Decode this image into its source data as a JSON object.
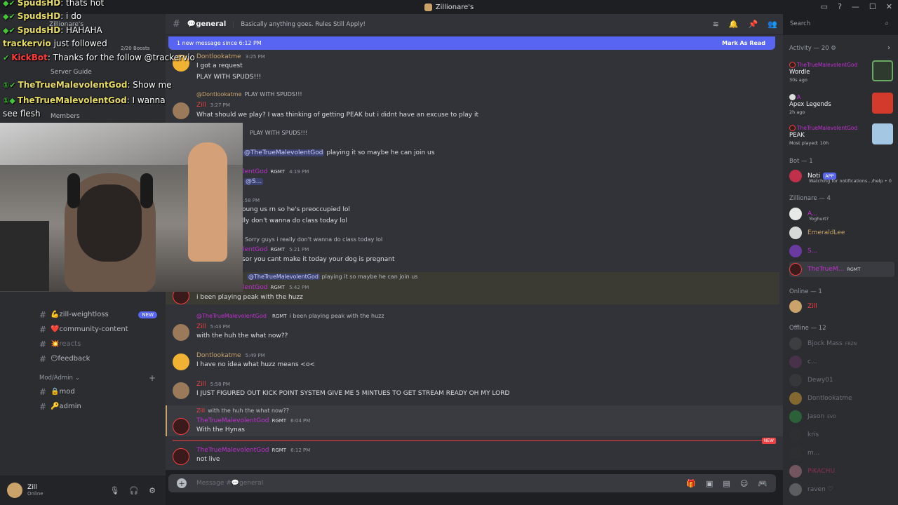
{
  "window": {
    "title": "Zillionare's"
  },
  "server": {
    "name": "Zillionare's",
    "boosts": "2/20 Boosts",
    "server_guide": "Server Guide",
    "members": "Members"
  },
  "channels": [
    {
      "name": "zill-weightloss",
      "emoji": "💪",
      "badge": "NEW"
    },
    {
      "name": "community-content",
      "emoji": "❤️"
    },
    {
      "name": "reacts",
      "emoji": "💥",
      "muted": true
    },
    {
      "name": "feedback",
      "emoji": "😶"
    }
  ],
  "category": {
    "name": "Mod/Admin",
    "channels": [
      {
        "name": "mod",
        "emoji": "🔒"
      },
      {
        "name": "admin",
        "emoji": "🔑"
      }
    ]
  },
  "user": {
    "name": "Zill",
    "status": "Online"
  },
  "header": {
    "channel": "💬general",
    "topic": "Basically anything goes. Rules Still Apply!",
    "search_placeholder": "Search"
  },
  "new_bar": {
    "text": "1 new message since 6:12 PM",
    "action": "Mark As Read"
  },
  "messages": [
    {
      "user": "Dontlookatme",
      "time": "3:25 PM",
      "lines": [
        "I got a request",
        "PLAY WITH SPUDS!!!"
      ]
    },
    {
      "reply_user": "@Dontlookatme",
      "reply_text": "PLAY WITH SPUDS!!!",
      "user": "Zill",
      "time": "3:27 PM",
      "lines": [
        "What should we play? I was thinking of getting PEAK but i didnt have an excuse to play it"
      ]
    },
    {
      "reply_text": "PLAY WITH SPUDS!!!",
      "mention": "@TheTrueMalevolentGod",
      "text_after": " playing it so maybe he can join us"
    },
    {
      "user": "lentGod",
      "tag": "RGMT",
      "time": "4:19 PM",
      "mention": "@S..."
    },
    {
      "time": "...58 PM",
      "lines": [
        "oung us rn so he's preoccupied lol",
        "lly don't wanna do class today lol"
      ]
    },
    {
      "reply_text": "Sorry guys i really don't wanna do class today lol",
      "user": "lentGod",
      "tag": "RGMT",
      "time": "5:21 PM",
      "lines": [
        "sor you cant make it today your dog is pregnant"
      ]
    },
    {
      "reply_mention": "@TheTrueMalevolentGod",
      "reply_text": "playing it so maybe he can join us",
      "user": "lentGod",
      "tag": "RGMT",
      "time": "5:42 PM",
      "lines": [
        "i been playing peak with the huzz"
      ]
    },
    {
      "reply_user": "@TheTrueMalevolentGod",
      "reply_tag": "RGMT",
      "reply_text": "i been playing peak with the huzz",
      "user": "Zill",
      "time": "5:43 PM",
      "lines": [
        "with the huh the what now??"
      ]
    },
    {
      "user": "Dontlookatme",
      "time": "5:49 PM",
      "lines": [
        "I have no idea what huzz means <o<"
      ]
    },
    {
      "user": "Zill",
      "time": "5:58 PM",
      "lines": [
        "I JUST FIGURED OUT KICK POINT SYSTEM GIVE ME 5 MINTUES TO GET STREAM READY OH MY LORD"
      ]
    },
    {
      "reply_user": "Zill",
      "reply_text": "with the huh the what now??",
      "user": "TheTrueMalevolentGod",
      "tag": "RGMT",
      "time": "6:04 PM",
      "lines": [
        "With the Hynas"
      ]
    },
    {
      "user": "TheTrueMalevolentGod",
      "tag": "RGMT",
      "time": "6:12 PM",
      "lines": [
        "not live"
      ]
    }
  ],
  "new_divider": "NEW",
  "composer": {
    "placeholder": "Message #💬general"
  },
  "activity": {
    "header": "Activity — 20",
    "items": [
      {
        "user": "TheTrueMalevolentGod",
        "game": "Wordle",
        "sub": "30s ago",
        "color": "#3a3a3a"
      },
      {
        "user": "A",
        "game": "Apex Legends",
        "sub": "2h ago",
        "color": "#d33a2c"
      },
      {
        "user": "TheTrueMalevolentGod",
        "game": "PEAK",
        "sub": "Most played: 10h",
        "color": "#a4c7e3"
      }
    ]
  },
  "bot_section": {
    "header": "Bot — 1",
    "name": "Noti",
    "badge": "APP",
    "sub": "Watching for notifications.. /help • 0"
  },
  "zillionare_section": {
    "header": "Zillionare — 4",
    "members": [
      {
        "name": "A...",
        "sub": "Yoghurt?",
        "color": "#c030d0"
      },
      {
        "name": "EmeraldLee",
        "color": "#c9a36a"
      },
      {
        "name": "S...",
        "color": "#c030d0"
      },
      {
        "name": "TheTrueM...",
        "tag": "RGMT",
        "color": "#c030d0"
      }
    ]
  },
  "online_section": {
    "header": "Online — 1",
    "members": [
      {
        "name": "Zill",
        "color": "#f23f43"
      }
    ]
  },
  "offline_section": {
    "header": "Offline — 12",
    "members": [
      {
        "name": "Bjock Mass",
        "tag": "FRZN"
      },
      {
        "name": "c..."
      },
      {
        "name": "Dewy01"
      },
      {
        "name": "Dontlookatme"
      },
      {
        "name": "Jason",
        "tag": "EVO"
      },
      {
        "name": "kris"
      },
      {
        "name": "m..."
      },
      {
        "name": "PiKACHU"
      },
      {
        "name": "raven ♡"
      }
    ]
  },
  "stream_overlay": [
    {
      "user": "SpudsHD",
      "msg": ": thats hot"
    },
    {
      "user": "SpudsHD",
      "msg": ": i do"
    },
    {
      "user": "SpudsHD",
      "msg": ": HAHAHA"
    },
    {
      "user": "trackervio",
      "msg": " just followed",
      "system": true
    },
    {
      "user": "KickBot",
      "msg": ": Thanks for the follow @trackervio",
      "red": true
    },
    {
      "user": "TheTrueMalevolentGod",
      "msg": ": Show me"
    },
    {
      "user": "TheTrueMalevolentGod",
      "msg": ": I wanna see flesh"
    }
  ]
}
